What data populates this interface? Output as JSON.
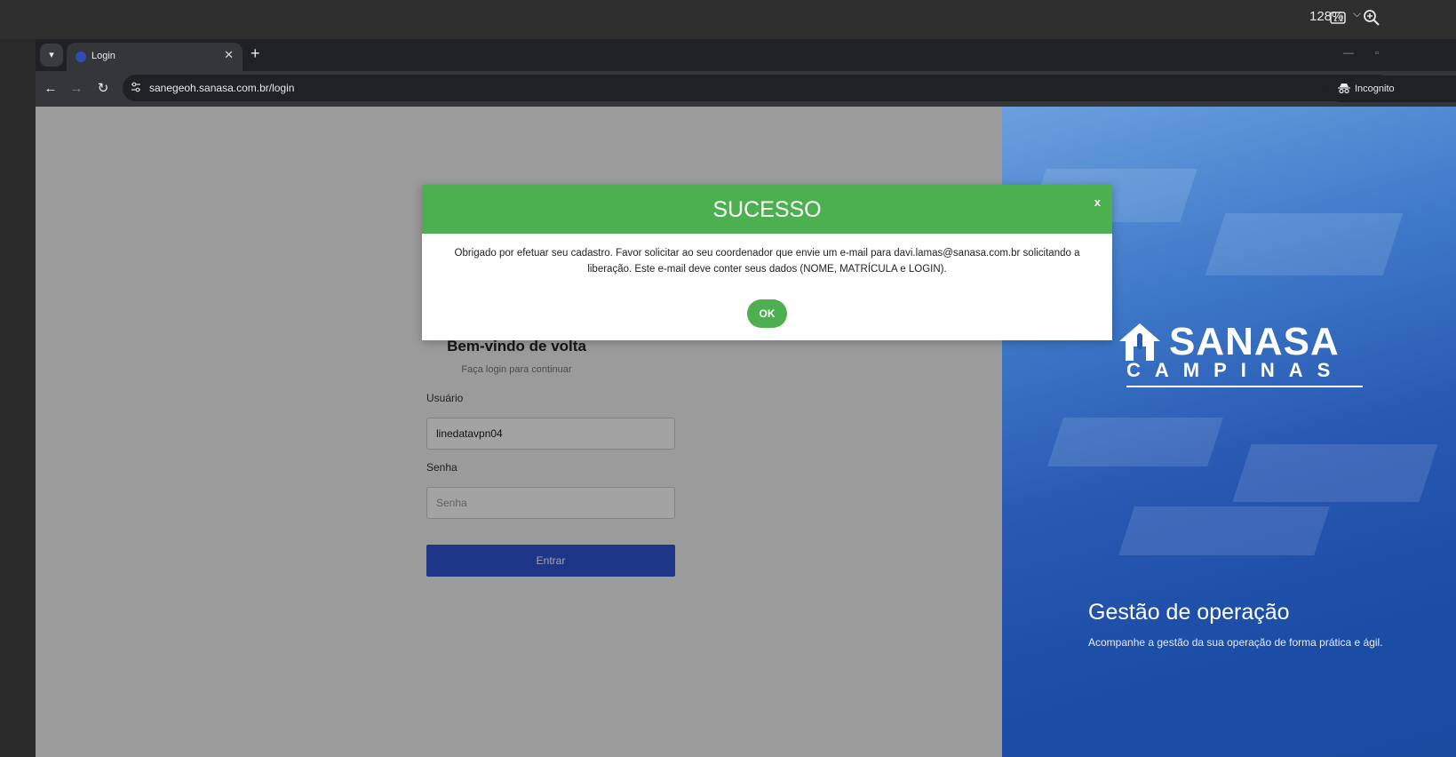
{
  "viewer": {
    "zoom": "128%"
  },
  "browser": {
    "tab": {
      "title": "Login"
    },
    "url": "sanegeoh.sanasa.com.br/login",
    "incognito_label": "Incognito"
  },
  "login": {
    "welcome": "Bem-vindo de volta",
    "subtitle": "Faça login para continuar",
    "username_label": "Usuário",
    "username_value": "linedatavpn04",
    "password_label": "Senha",
    "password_placeholder": "Senha",
    "submit_label": "Entrar"
  },
  "promo": {
    "logo_main": "SANASA",
    "logo_sub": "CAMPINAS",
    "title": "Gestão de operação",
    "text": "Acompanhe a gestão da sua operação de forma prática e ágil."
  },
  "modal": {
    "title": "SUCESSO",
    "close": "x",
    "message": "Obrigado por efetuar seu cadastro. Favor solicitar ao seu coordenador que envie um e-mail para davi.lamas@sanasa.com.br solicitando a liberação. Este e-mail deve conter seus dados (NOME, MATRÍCULA e LOGIN).",
    "ok_label": "OK"
  },
  "colors": {
    "success": "#4caf50",
    "primary_button": "#2f55d4",
    "brand_blue": "#2858b2"
  }
}
